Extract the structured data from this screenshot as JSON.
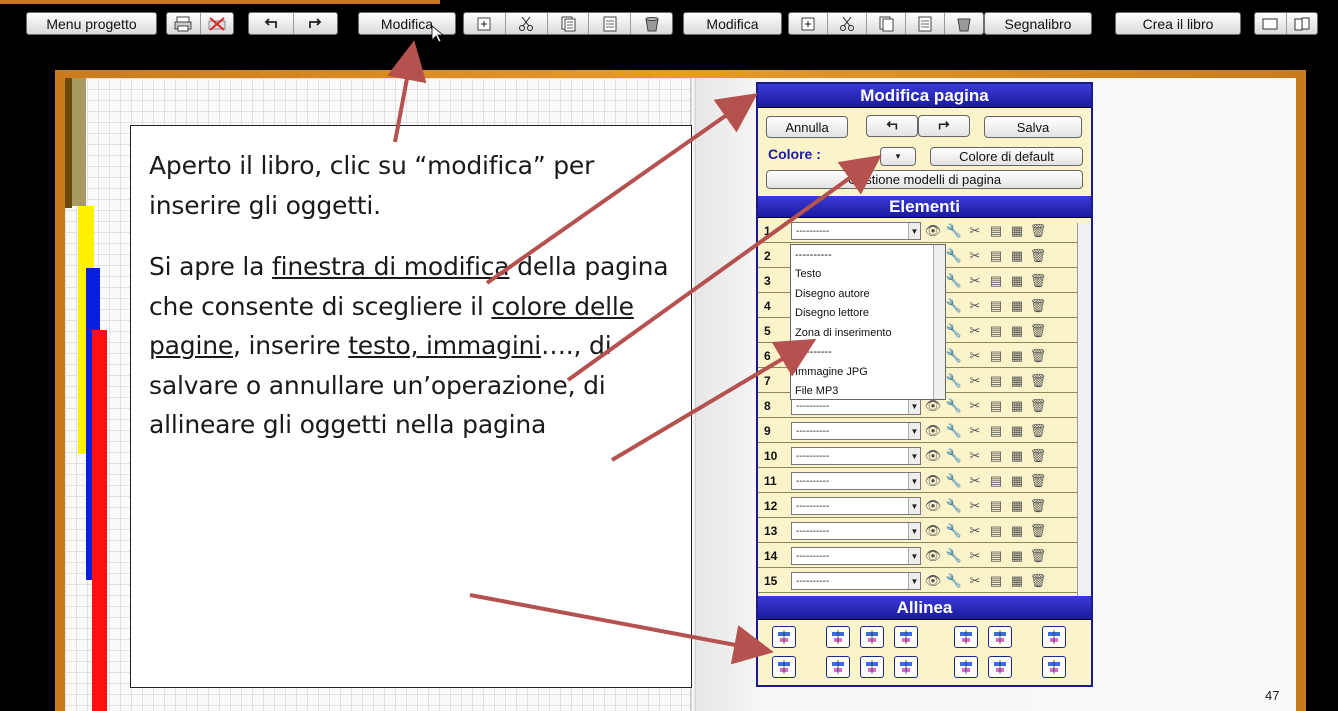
{
  "toolbar": {
    "menu_progetto": "Menu progetto",
    "modifica_1": "Modifica",
    "modifica_2": "Modifica",
    "segnalibro": "Segnalibro",
    "crea_libro": "Crea il libro"
  },
  "callout": {
    "para1": "Aperto il libro, clic su “modifica” per inserire gli oggetti.",
    "p2_a": "Si apre la ",
    "p2_link1": "finestra di modifica",
    "p2_b": " della pagina che consente di scegliere il ",
    "p2_link2": "colore delle pagine",
    "p2_c": ", inserire ",
    "p2_link3": "testo, immagini",
    "p2_d": "…., di salvare o annullare un’operazione, di allineare gli oggetti nella pagina"
  },
  "panel": {
    "title": "Modifica  pagina",
    "annulla": "Annulla",
    "salva": "Salva",
    "colore_label": "Colore :",
    "colore_default": "Colore di default",
    "gestione": "Gestione modelli di pagina",
    "elementi_title": "Elementi",
    "allinea_title": "Allinea",
    "rows": [
      "1",
      "2",
      "3",
      "4",
      "5",
      "6",
      "7",
      "8",
      "9",
      "10",
      "11",
      "12",
      "13",
      "14",
      "15"
    ],
    "row_value": "----------"
  },
  "dropdown": {
    "options": [
      "----------",
      "Testo",
      "Disegno autore",
      "Disegno lettore",
      "Zona di inserimento",
      "----------",
      "Immagine JPG",
      "File MP3"
    ]
  },
  "page_number": "47",
  "colors": {
    "arrow": "#b5514f",
    "panel_bg": "#fbf3c9",
    "panel_head": "#2424b8",
    "frame": "#d98b22"
  }
}
